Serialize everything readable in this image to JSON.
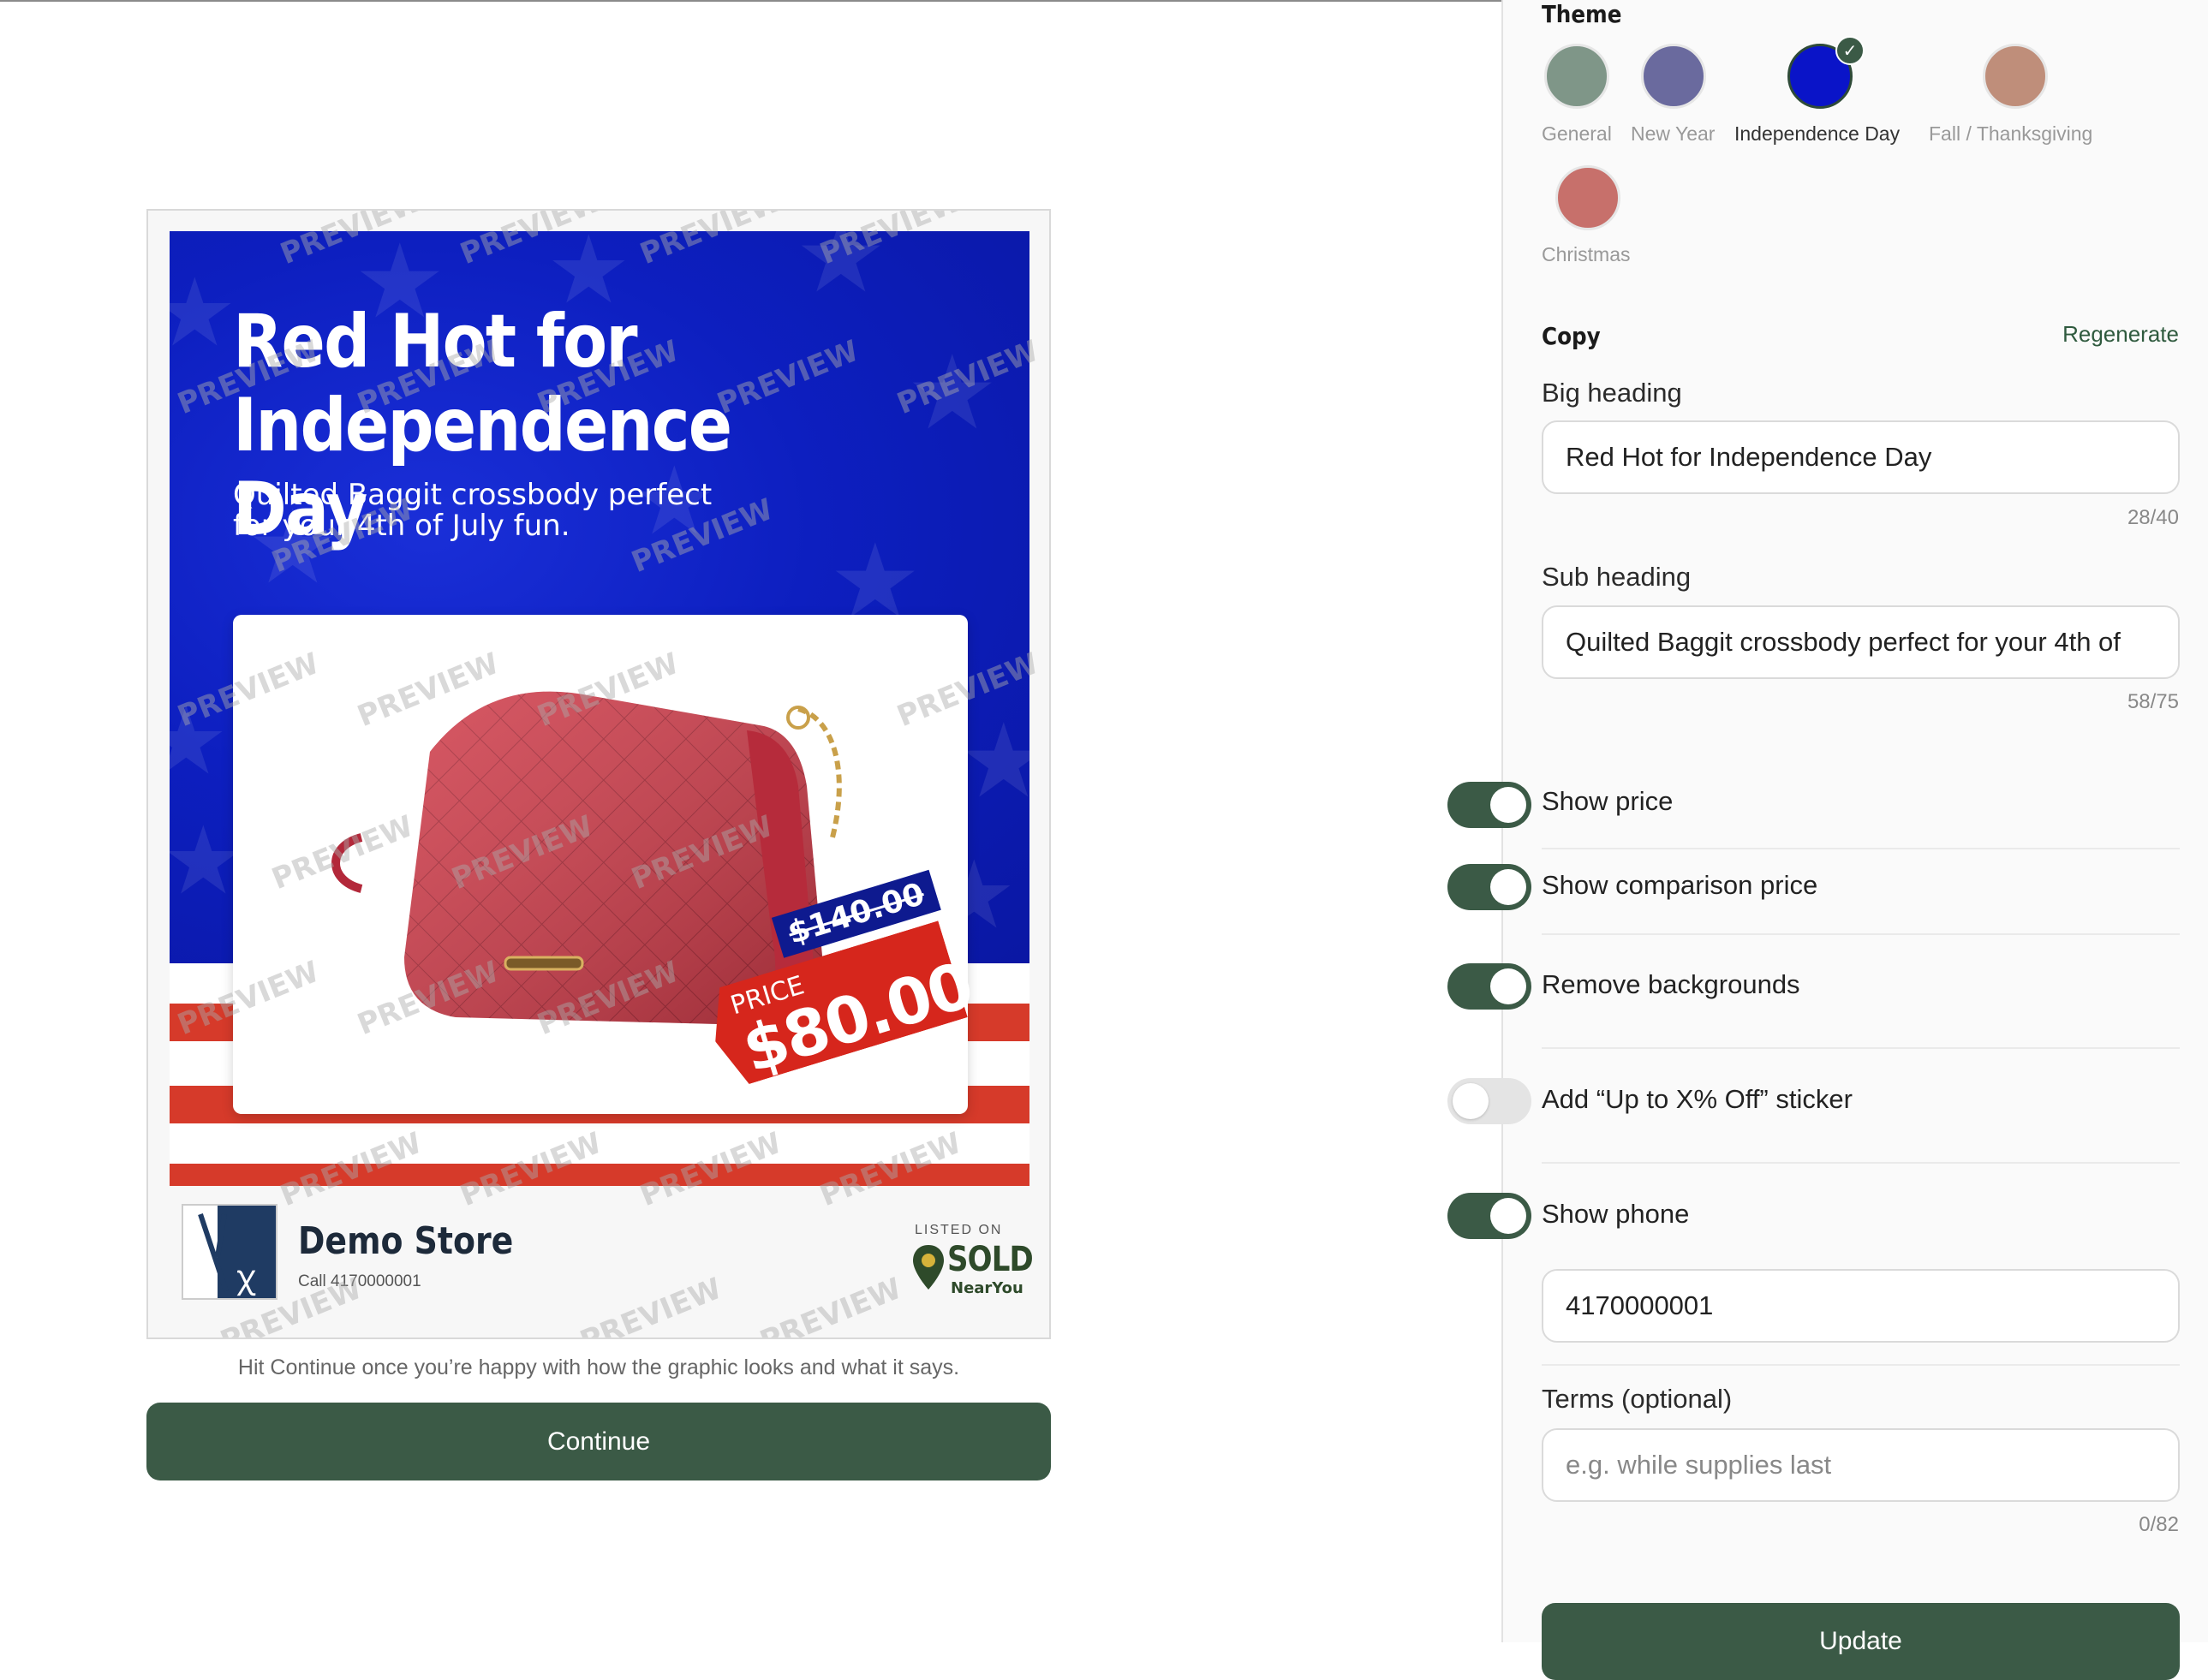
{
  "poster": {
    "heading_line1": "Red Hot for",
    "heading_line2": "Independence Day",
    "sub_line1": "Quilted Baggit crossbody perfect",
    "sub_line2": "for your 4th of July fun.",
    "price_label": "PRICE",
    "price": "$80.00",
    "compare_price": "$140.00",
    "watermark": "PREVIEW",
    "colors": {
      "blue": "#0d1fc0",
      "red": "#d63a2a",
      "white": "#ffffff"
    }
  },
  "footer": {
    "store_name": "Demo Store",
    "store_phone": "Call 4170000001",
    "listed_on": "LISTED ON",
    "sold_word": "SOLD",
    "near_you": "NearYou"
  },
  "hint": "Hit Continue once you’re happy with how the graphic looks and what it says.",
  "continue_label": "Continue",
  "panel": {
    "theme_title": "Theme",
    "themes": [
      {
        "label": "General",
        "color": "#7f9688",
        "selected": false
      },
      {
        "label": "New Year",
        "color": "#6a6a9e",
        "selected": false
      },
      {
        "label": "Independence Day",
        "color": "#0a14c8",
        "selected": true
      },
      {
        "label": "Fall / Thanksgiving",
        "color": "#bf8e7a",
        "selected": false
      },
      {
        "label": "Christmas",
        "color": "#c7706b",
        "selected": false
      }
    ],
    "copy_title": "Copy",
    "regenerate": "Regenerate",
    "big_heading_label": "Big heading",
    "big_heading_value": "Red Hot for Independence Day",
    "big_heading_count": "28/40",
    "sub_heading_label": "Sub heading",
    "sub_heading_value": "Quilted Baggit crossbody perfect for your 4th of",
    "sub_heading_count": "58/75",
    "toggles": [
      {
        "label": "Show price",
        "on": true
      },
      {
        "label": "Show comparison price",
        "on": true
      },
      {
        "label": "Remove backgrounds",
        "on": true
      },
      {
        "label": "Add “Up to X% Off” sticker",
        "on": false
      },
      {
        "label": "Show phone",
        "on": true
      }
    ],
    "phone_value": "4170000001",
    "terms_label": "Terms (optional)",
    "terms_placeholder": "e.g. while supplies last",
    "terms_count": "0/82",
    "update_label": "Update",
    "accent": "#3b5a46"
  }
}
